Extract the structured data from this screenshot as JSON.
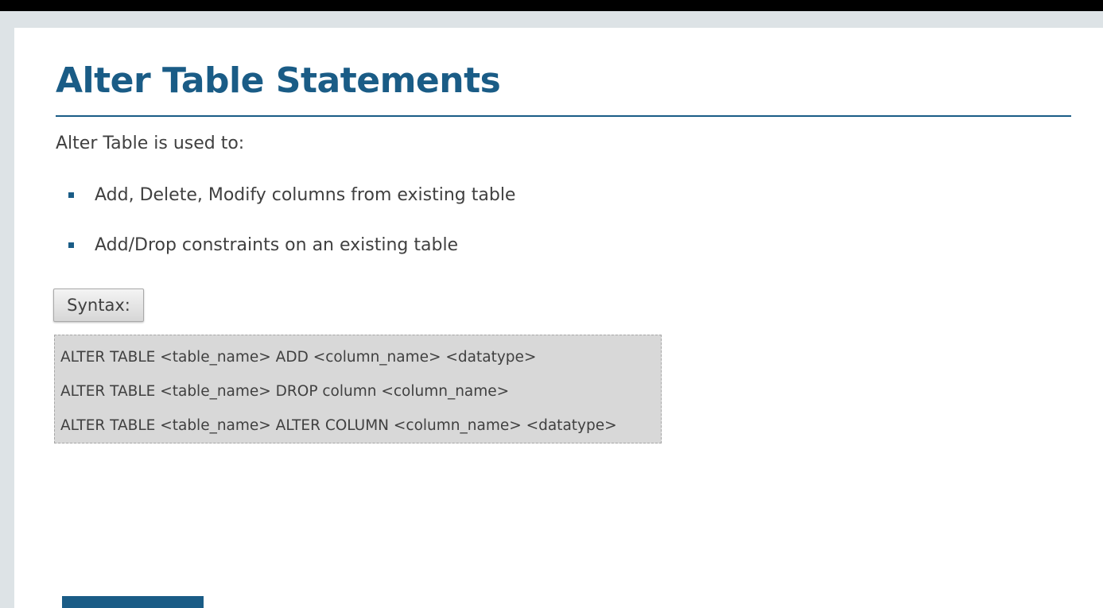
{
  "slide": {
    "title": "Alter Table Statements",
    "intro": "Alter Table is used to:",
    "bullets": [
      "Add, Delete, Modify columns from existing table",
      "Add/Drop constraints on an existing table"
    ],
    "syntax_label": "Syntax:",
    "syntax_lines": [
      "ALTER TABLE <table_name> ADD <column_name> <datatype>",
      "ALTER TABLE <table_name> DROP column <column_name>",
      "ALTER TABLE <table_name> ALTER COLUMN <column_name> <datatype>"
    ]
  },
  "colors": {
    "accent": "#1a5c86",
    "body_text": "#404040",
    "code_background": "#d8d8d8",
    "frame": "#dde3e6"
  }
}
